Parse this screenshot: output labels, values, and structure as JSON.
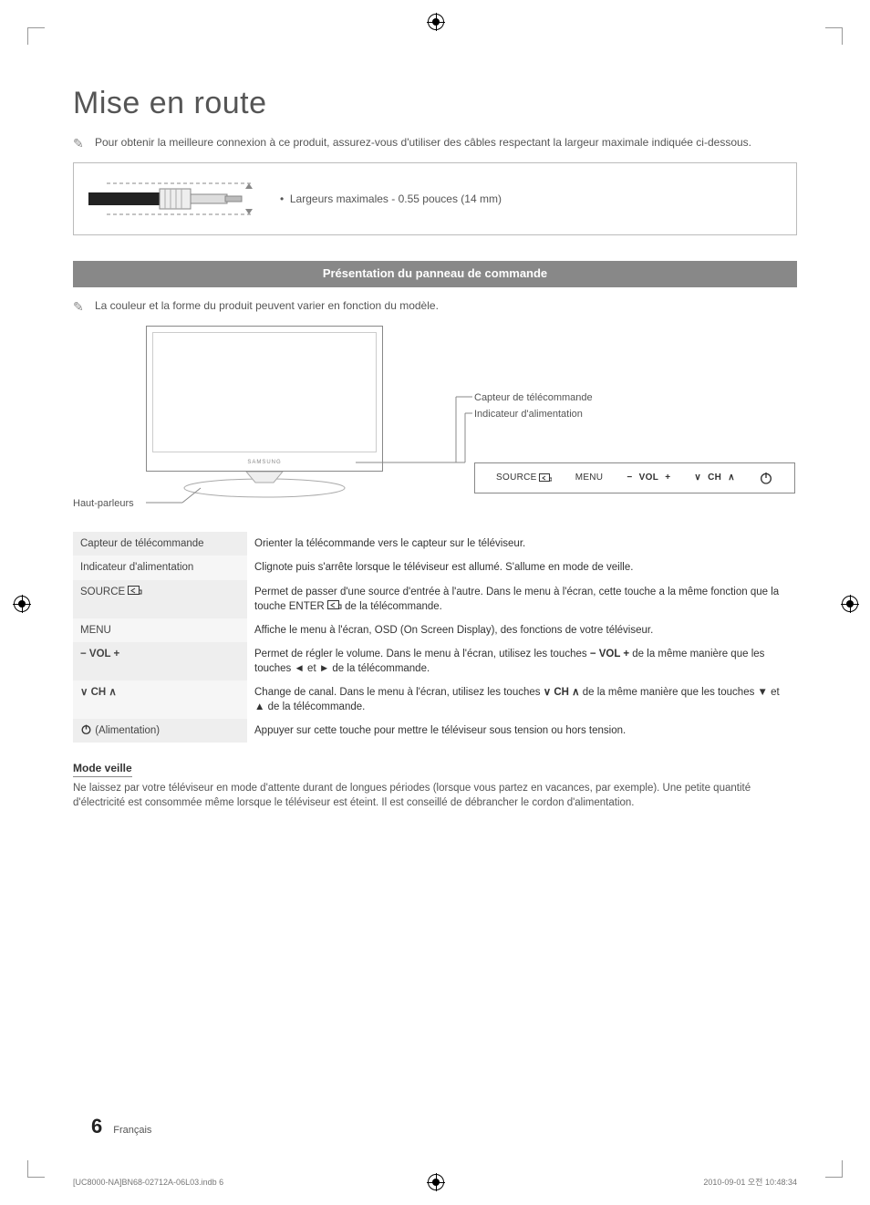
{
  "title": "Mise en route",
  "note_cable": "Pour obtenir la meilleure connexion à ce produit, assurez-vous d'utiliser des câbles respectant la largeur maximale indiquée ci-dessous.",
  "cable_spec": "Largeurs maximales - 0.55 pouces (14 mm)",
  "section_heading": "Présentation du panneau de commande",
  "note_variation": "La couleur et la forme du produit peuvent varier en fonction du modèle.",
  "diagram": {
    "sensor_label": "Capteur de télécommande",
    "power_indicator_label": "Indicateur d'alimentation",
    "speakers_label": "Haut-parleurs",
    "panel": {
      "source": "SOURCE",
      "menu": "MENU",
      "vol": "VOL",
      "ch": "CH"
    }
  },
  "table": [
    {
      "label": "Capteur de télécommande",
      "desc": "Orienter la télécommande vers le capteur sur le téléviseur."
    },
    {
      "label": "Indicateur d'alimentation",
      "desc": "Clignote puis s'arrête lorsque le téléviseur est allumé. S'allume en mode de veille."
    },
    {
      "label": "SOURCE",
      "icon": "enter",
      "desc_pre": "Permet de passer d'une source d'entrée à l'autre. Dans le menu à l'écran, cette touche a la même fonction que la touche ENTER",
      "desc_post": " de la télécommande."
    },
    {
      "label": "MENU",
      "desc": "Affiche le menu à l'écran, OSD (On Screen Display), des fonctions de votre téléviseur."
    },
    {
      "label_vol": true,
      "desc_pre": "Permet de régler le volume. Dans le menu à l'écran, utilisez les touches ",
      "desc_mid": " de la même manière que les touches ◄ et ► de la télécommande."
    },
    {
      "label_ch": true,
      "desc_pre": "Change de canal. Dans le menu à l'écran, utilisez les touches ",
      "desc_mid": " de la même manière que les touches ▼ et ▲ de la télécommande."
    },
    {
      "label_power": true,
      "label_power_text": " (Alimentation)",
      "desc": "Appuyer sur cette touche pour mettre le téléviseur sous tension ou hors tension."
    }
  ],
  "standby": {
    "heading": "Mode veille",
    "text": "Ne laissez par votre téléviseur en mode d'attente durant de longues périodes (lorsque vous partez en vacances, par exemple). Une petite quantité d'électricité est consommée même lorsque le téléviseur est éteint. Il est conseillé de débrancher le cordon d'alimentation."
  },
  "footer": {
    "page_number": "6",
    "language": "Français"
  },
  "print": {
    "file": "[UC8000-NA]BN68-02712A-06L03.indb   6",
    "timestamp": "2010-09-01   오전 10:48:34"
  }
}
